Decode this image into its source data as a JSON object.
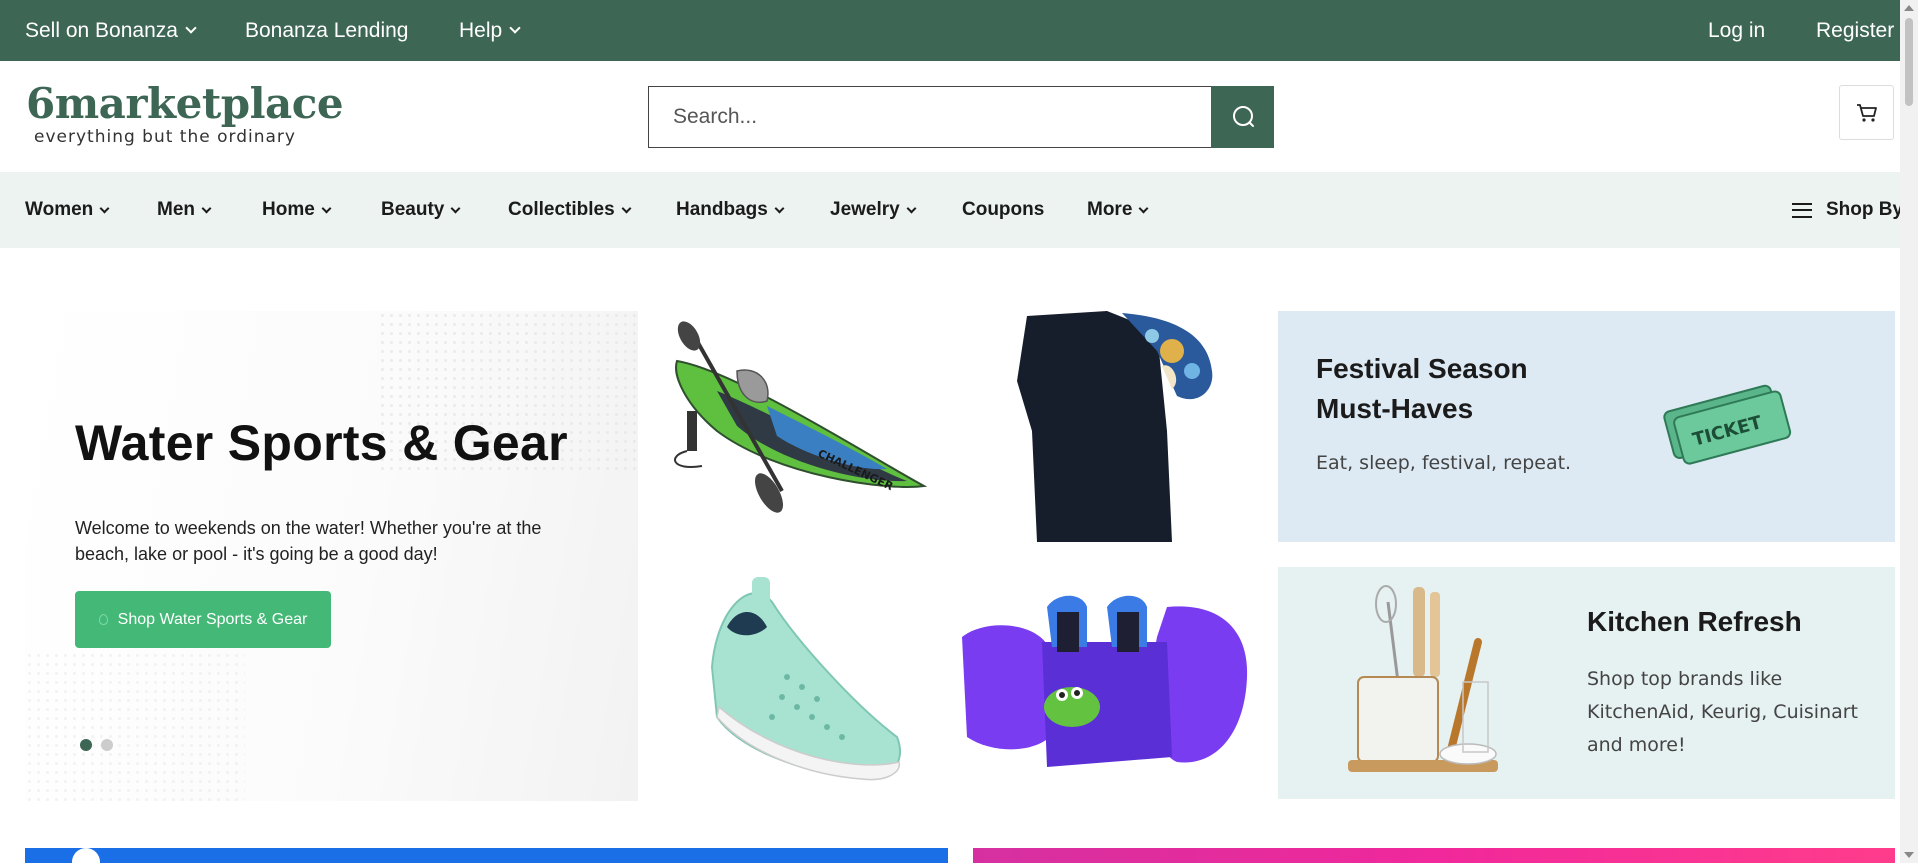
{
  "topbar": {
    "sell": "Sell on Bonanza",
    "lending": "Bonanza Lending",
    "help": "Help",
    "login": "Log in",
    "register": "Register"
  },
  "header": {
    "logo_word": "6marketplace",
    "logo_tagline": "everything but the ordinary",
    "search_placeholder": "Search..."
  },
  "nav": {
    "items": [
      "Women",
      "Men",
      "Home",
      "Beauty",
      "Collectibles",
      "Handbags",
      "Jewelry",
      "Coupons",
      "More"
    ],
    "shop_by": "Shop By"
  },
  "hero": {
    "title": "Water Sports & Gear",
    "description": "Welcome to weekends on the water! Whether you're at the beach, lake or pool - it's going be a good day!",
    "cta": "Shop Water Sports & Gear",
    "slides_total": 2,
    "active_slide": 1
  },
  "tiles": [
    {
      "icon": "kayak-image"
    },
    {
      "icon": "rash-guard-shirt-image"
    },
    {
      "icon": "water-shoe-image"
    },
    {
      "icon": "swim-vest-image"
    }
  ],
  "promos": {
    "festival": {
      "title": "Festival Season Must-Haves",
      "subtitle": "Eat, sleep, festival, repeat.",
      "ticket_text": "TICKET"
    },
    "kitchen": {
      "title": "Kitchen Refresh",
      "subtitle": "Shop top brands like KitchenAid, Keurig, Cuisinart and more!"
    }
  },
  "colors": {
    "brand_green": "#3e6655",
    "cta_green": "#44b977",
    "nav_bg": "#edf3f1",
    "festival_bg": "#ddeaf3",
    "kitchen_bg": "#e6f1f2"
  }
}
